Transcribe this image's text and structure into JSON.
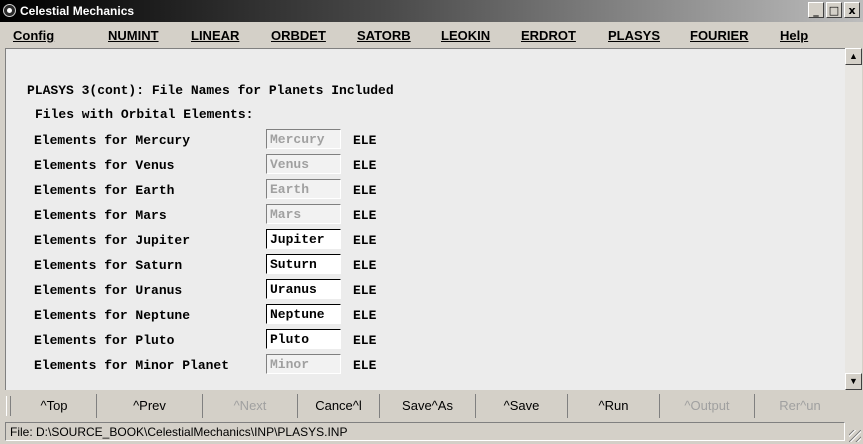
{
  "window": {
    "title": "Celestial Mechanics",
    "minimize": "_",
    "maximize": "□",
    "close": "x"
  },
  "menu": [
    "Config",
    "NUMINT",
    "LINEAR",
    "ORBDET",
    "SATORB",
    "LEOKIN",
    "ERDROT",
    "PLASYS",
    "FOURIER",
    "Help"
  ],
  "form": {
    "heading": "PLASYS 3(cont): File Names for Planets Included",
    "subheading": "Files with Orbital Elements:",
    "rows": [
      {
        "label": "Elements for Mercury",
        "value": "Mercury",
        "enabled": false,
        "ext": "ELE"
      },
      {
        "label": "Elements for Venus",
        "value": "Venus",
        "enabled": false,
        "ext": "ELE"
      },
      {
        "label": "Elements for Earth",
        "value": "Earth",
        "enabled": false,
        "ext": "ELE"
      },
      {
        "label": "Elements for Mars",
        "value": "Mars",
        "enabled": false,
        "ext": "ELE"
      },
      {
        "label": "Elements for Jupiter",
        "value": "Jupiter",
        "enabled": true,
        "ext": "ELE"
      },
      {
        "label": "Elements for Saturn",
        "value": "Suturn",
        "enabled": true,
        "ext": "ELE"
      },
      {
        "label": "Elements for Uranus",
        "value": "Uranus",
        "enabled": true,
        "ext": "ELE"
      },
      {
        "label": "Elements for Neptune",
        "value": "Neptune",
        "enabled": true,
        "ext": "ELE"
      },
      {
        "label": "Elements for Pluto",
        "value": "Pluto",
        "enabled": true,
        "ext": "ELE"
      },
      {
        "label": "Elements for Minor Planet",
        "value": "Minor",
        "enabled": false,
        "ext": "ELE"
      }
    ]
  },
  "scrollbar": {
    "up_icon": "arrow-up-icon",
    "down_icon": "arrow-down-icon"
  },
  "toolbar": [
    {
      "label": "^Top",
      "enabled": true
    },
    {
      "label": "^Prev",
      "enabled": true
    },
    {
      "label": "^Next",
      "enabled": false
    },
    {
      "label": "Cance^l",
      "enabled": true
    },
    {
      "label": "Save^As",
      "enabled": true
    },
    {
      "label": "^Save",
      "enabled": true
    },
    {
      "label": "^Run",
      "enabled": true
    },
    {
      "label": "^Output",
      "enabled": false
    },
    {
      "label": "Rer^un",
      "enabled": false
    }
  ],
  "status": {
    "text": "File: D:\\SOURCE_BOOK\\CelestialMechanics\\INP\\PLASYS.INP"
  }
}
